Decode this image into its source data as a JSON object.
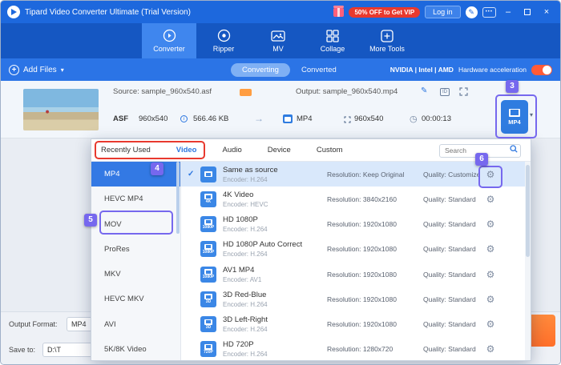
{
  "titlebar": {
    "title": "Tipard Video Converter Ultimate (Trial Version)",
    "vip_badge": "50% OFF to Get VIP",
    "login": "Log in"
  },
  "nav": {
    "active": 0,
    "tabs": [
      "Converter",
      "Ripper",
      "MV",
      "Collage",
      "More Tools"
    ]
  },
  "toolbar": {
    "add_files": "Add Files",
    "converting": "Converting",
    "converted": "Converted",
    "brands": "NVIDIA | Intel | AMD",
    "hw_label": "Hardware acceleration"
  },
  "file": {
    "source": "Source: sample_960x540.asf",
    "output": "Output: sample_960x540.mp4",
    "container": "ASF",
    "src_res": "960x540",
    "size": "566.46 KB",
    "dst": "MP4",
    "dst_res": "960x540",
    "duration": "00:00:13",
    "profile": "MP4",
    "id_tag": "ID"
  },
  "panel": {
    "search_placeholder": "Search",
    "tabs": {
      "active": 1,
      "items": [
        "Recently Used",
        "Video",
        "Audio",
        "Device",
        "Custom"
      ]
    },
    "sidebar": {
      "active": 0,
      "items": [
        "MP4",
        "HEVC MP4",
        "MOV",
        "ProRes",
        "MKV",
        "HEVC MKV",
        "AVI",
        "5K/8K Video"
      ]
    },
    "formats": [
      {
        "name": "Same as source",
        "encoder": "Encoder: H.264",
        "resolution": "Resolution: Keep Original",
        "quality": "Quality: Customize",
        "badge": "",
        "selected": true
      },
      {
        "name": "4K Video",
        "encoder": "Encoder: HEVC",
        "resolution": "Resolution: 3840x2160",
        "quality": "Quality: Standard",
        "badge": "4K",
        "selected": false
      },
      {
        "name": "HD 1080P",
        "encoder": "Encoder: H.264",
        "resolution": "Resolution: 1920x1080",
        "quality": "Quality: Standard",
        "badge": "1080P",
        "selected": false
      },
      {
        "name": "HD 1080P Auto Correct",
        "encoder": "Encoder: H.264",
        "resolution": "Resolution: 1920x1080",
        "quality": "Quality: Standard",
        "badge": "1080P",
        "selected": false
      },
      {
        "name": "AV1 MP4",
        "encoder": "Encoder: AV1",
        "resolution": "Resolution: 1920x1080",
        "quality": "Quality: Standard",
        "badge": "1080P",
        "selected": false
      },
      {
        "name": "3D Red-Blue",
        "encoder": "Encoder: H.264",
        "resolution": "Resolution: 1920x1080",
        "quality": "Quality: Standard",
        "badge": "3D",
        "selected": false
      },
      {
        "name": "3D Left-Right",
        "encoder": "Encoder: H.264",
        "resolution": "Resolution: 1920x1080",
        "quality": "Quality: Standard",
        "badge": "3D",
        "selected": false
      },
      {
        "name": "HD 720P",
        "encoder": "Encoder: H.264",
        "resolution": "Resolution: 1280x720",
        "quality": "Quality: Standard",
        "badge": "720P",
        "selected": false
      }
    ]
  },
  "bottom": {
    "output_format_label": "Output Format:",
    "output_format_value": "MP4",
    "save_to_label": "Save to:",
    "save_to_value": "D:\\T"
  },
  "annotations": {
    "n3": "3",
    "n4": "4",
    "n5": "5",
    "n6": "6"
  },
  "icons": {
    "pencil": "✎",
    "gear": "⚙",
    "check": "✓",
    "caret": "▾",
    "clock": "◷",
    "arrow": "→",
    "dots": "•••",
    "minimize": "–",
    "close": "×",
    "plus": "+",
    "i": "i"
  },
  "colors": {
    "accent_blue": "#2d77e0",
    "annotation_purple": "#7668ee",
    "callout_red": "#e8392e",
    "toggle_orange": "#ff5a36",
    "vip_red": "#e8392e",
    "convert_orange": "#ff7a2f"
  }
}
